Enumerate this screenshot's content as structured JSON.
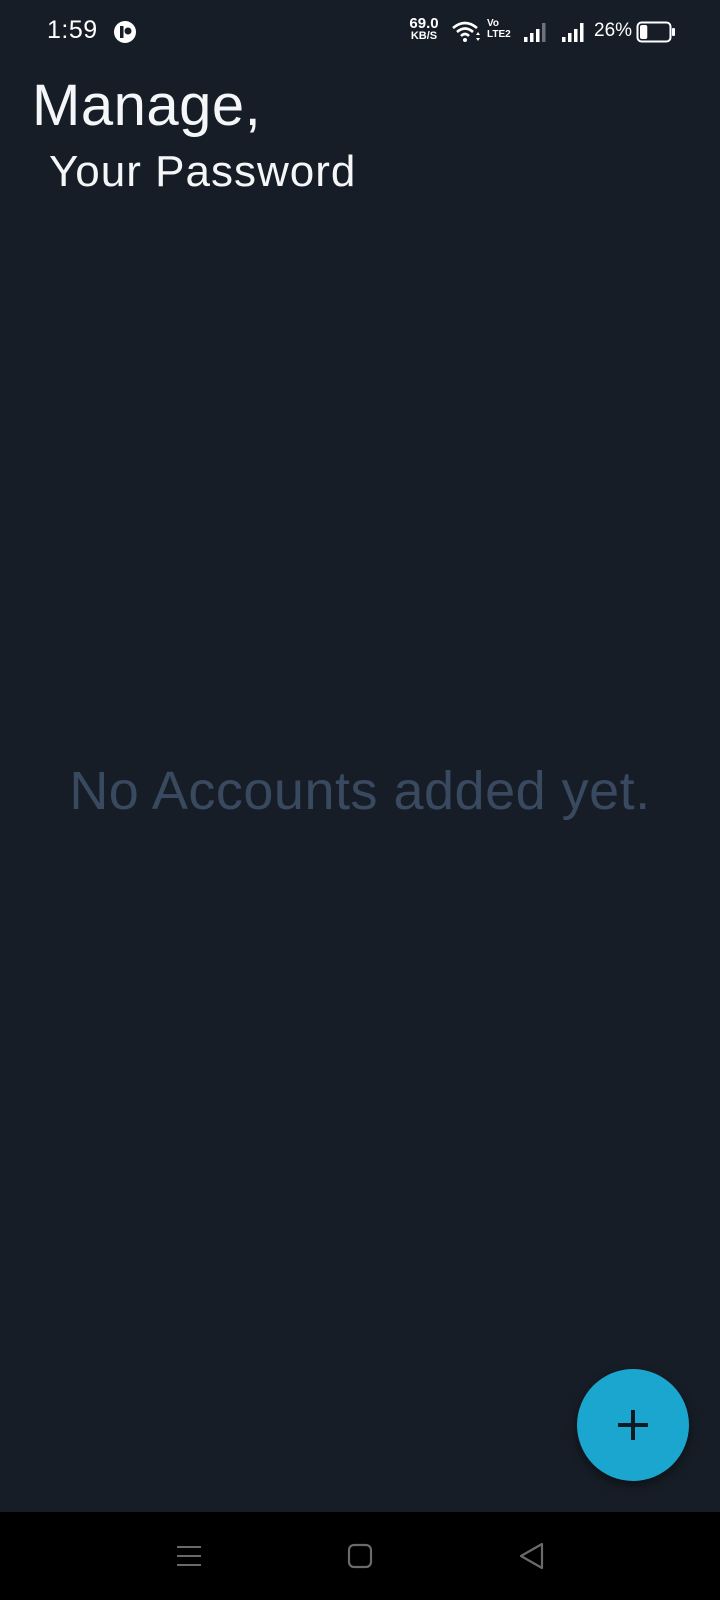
{
  "status_bar": {
    "time": "1:59",
    "net_speed_value": "69.0",
    "net_speed_unit": "KB/S",
    "volte_top": "Vo",
    "volte_bottom": "LTE2",
    "battery_percent": "26%",
    "battery_level": 0.26,
    "icons": [
      "notification-app-icon",
      "wifi-icon",
      "volte-icon",
      "signal-icon",
      "signal-icon",
      "battery-icon"
    ]
  },
  "header": {
    "title_line1": "Manage,",
    "title_line2": "Your Password"
  },
  "main": {
    "empty_message": "No Accounts added yet."
  },
  "fab": {
    "icon": "plus-icon",
    "color": "#1aa6cf"
  },
  "nav_bar": {
    "icons": [
      "menu-icon",
      "home-square-icon",
      "back-triangle-icon"
    ]
  },
  "colors": {
    "background": "#171d26",
    "empty_text": "#39495f",
    "accent": "#1aa6cf"
  }
}
